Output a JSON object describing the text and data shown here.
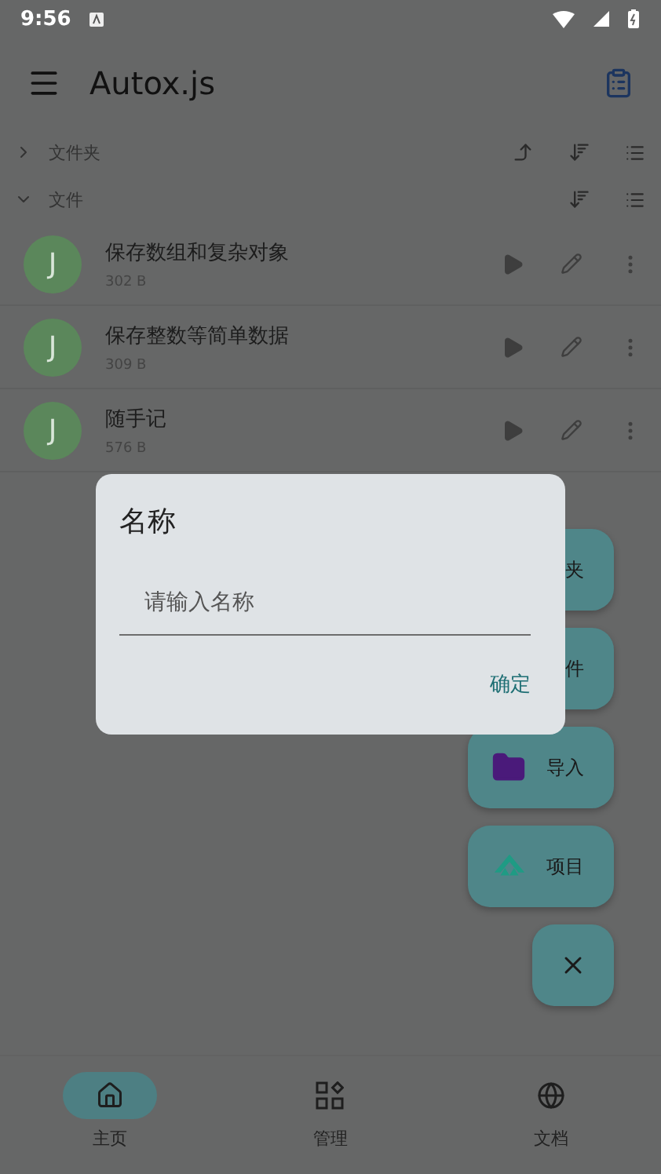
{
  "status_bar": {
    "time": "9:56"
  },
  "app_bar": {
    "title": "Autox.js"
  },
  "sections": [
    {
      "label": "文件夹",
      "expanded": false,
      "kind": "folders"
    },
    {
      "label": "文件",
      "expanded": true,
      "kind": "files"
    }
  ],
  "files": [
    {
      "avatar": "J",
      "name": "保存数组和复杂对象",
      "size": "302 B"
    },
    {
      "avatar": "J",
      "name": "保存整数等简单数据",
      "size": "309 B"
    },
    {
      "avatar": "J",
      "name": "随手记",
      "size": "576 B"
    }
  ],
  "fab_menu": [
    {
      "kind": "hidden",
      "label": "夹"
    },
    {
      "kind": "hidden",
      "label": "件"
    },
    {
      "kind": "folder",
      "label": "导入"
    },
    {
      "kind": "project",
      "label": "项目"
    }
  ],
  "dialog": {
    "title": "名称",
    "placeholder": "请输入名称",
    "confirm": "确定"
  },
  "bottom_nav": [
    {
      "kind": "home",
      "label": "主页",
      "selected": true
    },
    {
      "kind": "manage",
      "label": "管理",
      "selected": false
    },
    {
      "kind": "docs",
      "label": "文档",
      "selected": false
    }
  ]
}
